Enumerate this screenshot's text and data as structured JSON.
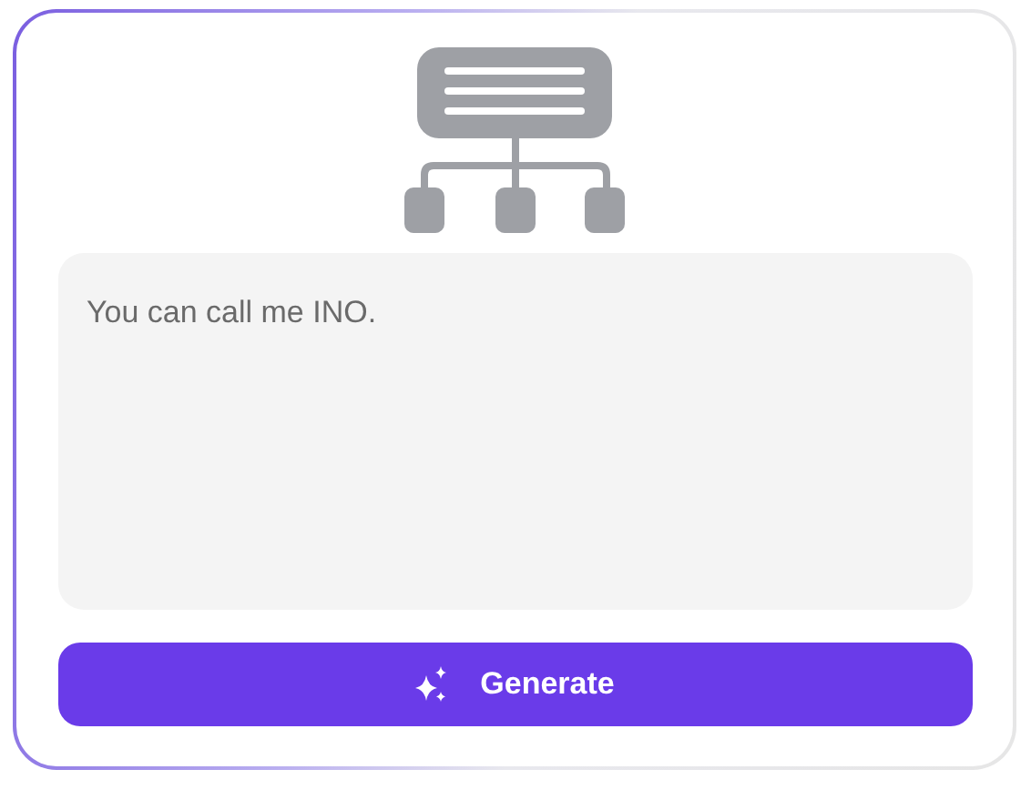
{
  "prompt_field": {
    "value": "You can call me INO."
  },
  "generate_button": {
    "label": "Generate"
  }
}
